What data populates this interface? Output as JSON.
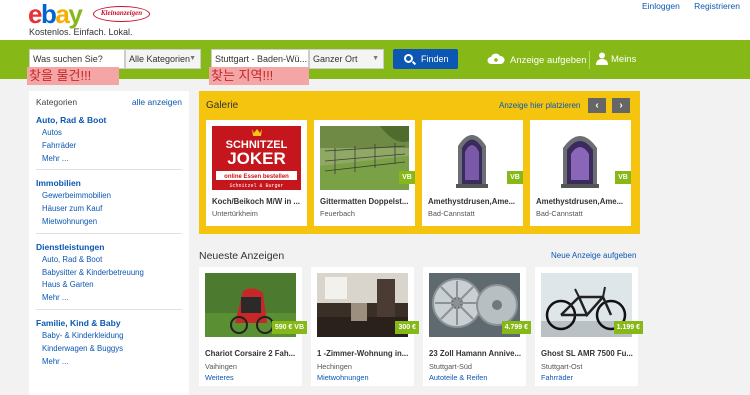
{
  "header": {
    "logo_text": [
      "e",
      "b",
      "a",
      "y"
    ],
    "sub_logo": "Kleinanzeigen",
    "tagline": "Kostenlos. Einfach. Lokal.",
    "login": "Einloggen",
    "register": "Registrieren"
  },
  "search": {
    "query_value": "Was suchen Sie?",
    "category": "Alle Kategorien",
    "location_value": "Stuttgart - Baden-Wü...",
    "radius": "Ganzer Ort",
    "find_button": "Finden",
    "post_ad": "Anzeige aufgeben",
    "meins": "Meins"
  },
  "annotations": {
    "left": "찾을 물건!!!",
    "right": "찾는 지역!!!"
  },
  "sidebar": {
    "header": "Kategorien",
    "all_link": "alle anzeigen",
    "categories": [
      {
        "title": "Auto, Rad & Boot",
        "links": [
          "Autos",
          "Fahrräder",
          "Mehr ..."
        ]
      },
      {
        "title": "Immobilien",
        "links": [
          "Gewerbeimmobilien",
          "Häuser zum Kauf",
          "Mietwohnungen"
        ]
      },
      {
        "title": "Dienstleistungen",
        "links": [
          "Auto, Rad & Boot",
          "Babysitter & Kinderbetreuung",
          "Haus & Garten",
          "Mehr ..."
        ]
      },
      {
        "title": "Familie, Kind & Baby",
        "links": [
          "Baby- & Kinderkleidung",
          "Kinderwagen & Buggys",
          "Mehr ..."
        ]
      }
    ]
  },
  "galerie": {
    "title": "Galerie",
    "place_link": "Anzeige hier platzieren",
    "prev": "‹",
    "next": "›",
    "items": [
      {
        "title": "Koch/Beikoch M/W in ...",
        "location": "Untertürkheim",
        "badge": "",
        "img_text": [
          "SCHNITZEL",
          "JOKER",
          "online Essen bestellen",
          "Schnitzel & Burger"
        ]
      },
      {
        "title": "Gittermatten Doppelst...",
        "location": "Feuerbach",
        "badge": "VB"
      },
      {
        "title": "Amethystdrusen,Ame...",
        "location": "Bad-Cannstatt",
        "badge": "VB"
      },
      {
        "title": "Amethystdrusen,Ame...",
        "location": "Bad-Cannstatt",
        "badge": "VB"
      }
    ]
  },
  "neueste": {
    "title": "Neueste Anzeigen",
    "new_link": "Neue Anzeige aufgeben",
    "items": [
      {
        "title": "Chariot Corsaire 2 Fah...",
        "location": "Vaihingen",
        "category": "Weiteres",
        "price": "590 € VB"
      },
      {
        "title": "1 -Zimmer-Wohnung in...",
        "location": "Hechingen",
        "category": "Mietwohnungen",
        "price": "300 €"
      },
      {
        "title": "23 Zoll Hamann Annive...",
        "location": "Stuttgart-Süd",
        "category": "Autoteile & Reifen",
        "price": "4.799 €"
      },
      {
        "title": "Ghost SL AMR 7500 Fu...",
        "location": "Stuttgart-Ost",
        "category": "Fahrräder",
        "price": "1.199 €"
      }
    ]
  }
}
